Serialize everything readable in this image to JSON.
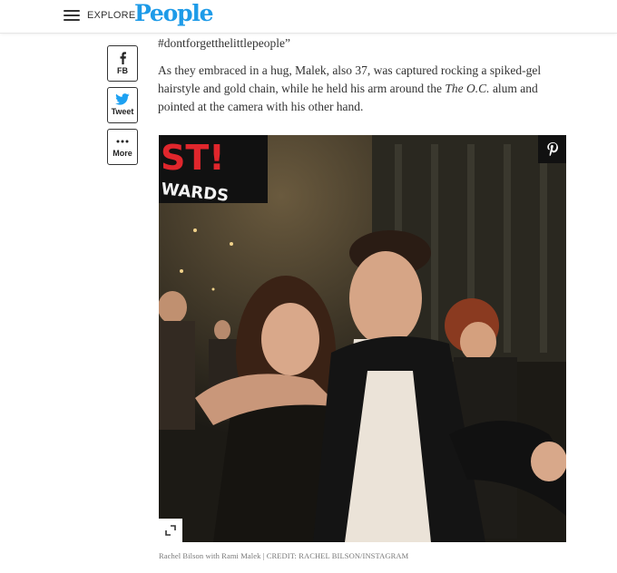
{
  "header": {
    "menu_label": "EXPLORE",
    "logo_text": "People",
    "logo_color": "#1e9be8"
  },
  "share": {
    "facebook": {
      "icon": "facebook-icon",
      "label": "FB"
    },
    "twitter": {
      "icon": "twitter-icon",
      "label": "Tweet",
      "color": "#1da1f2"
    },
    "more": {
      "icon": "more-dots-icon",
      "label": "More"
    }
  },
  "article": {
    "hashtag_line": "#dontforgetthelittlepeople”",
    "paragraph_before": "As they embraced in a hug, Malek, also 37, was captured rocking a spiked-gel hairstyle and gold chain, while he held his arm around the ",
    "paragraph_emphasis": "The O.C.",
    "paragraph_after": " alum and pointed at the camera with his other hand."
  },
  "photo": {
    "sign_line1": "ST!",
    "sign_line2": "WARDS",
    "pin_icon": "pinterest-icon",
    "expand_icon": "expand-icon"
  },
  "caption": "Rachel Bilson with Rami Malek | CREDIT: RACHEL BILSON/INSTAGRAM"
}
